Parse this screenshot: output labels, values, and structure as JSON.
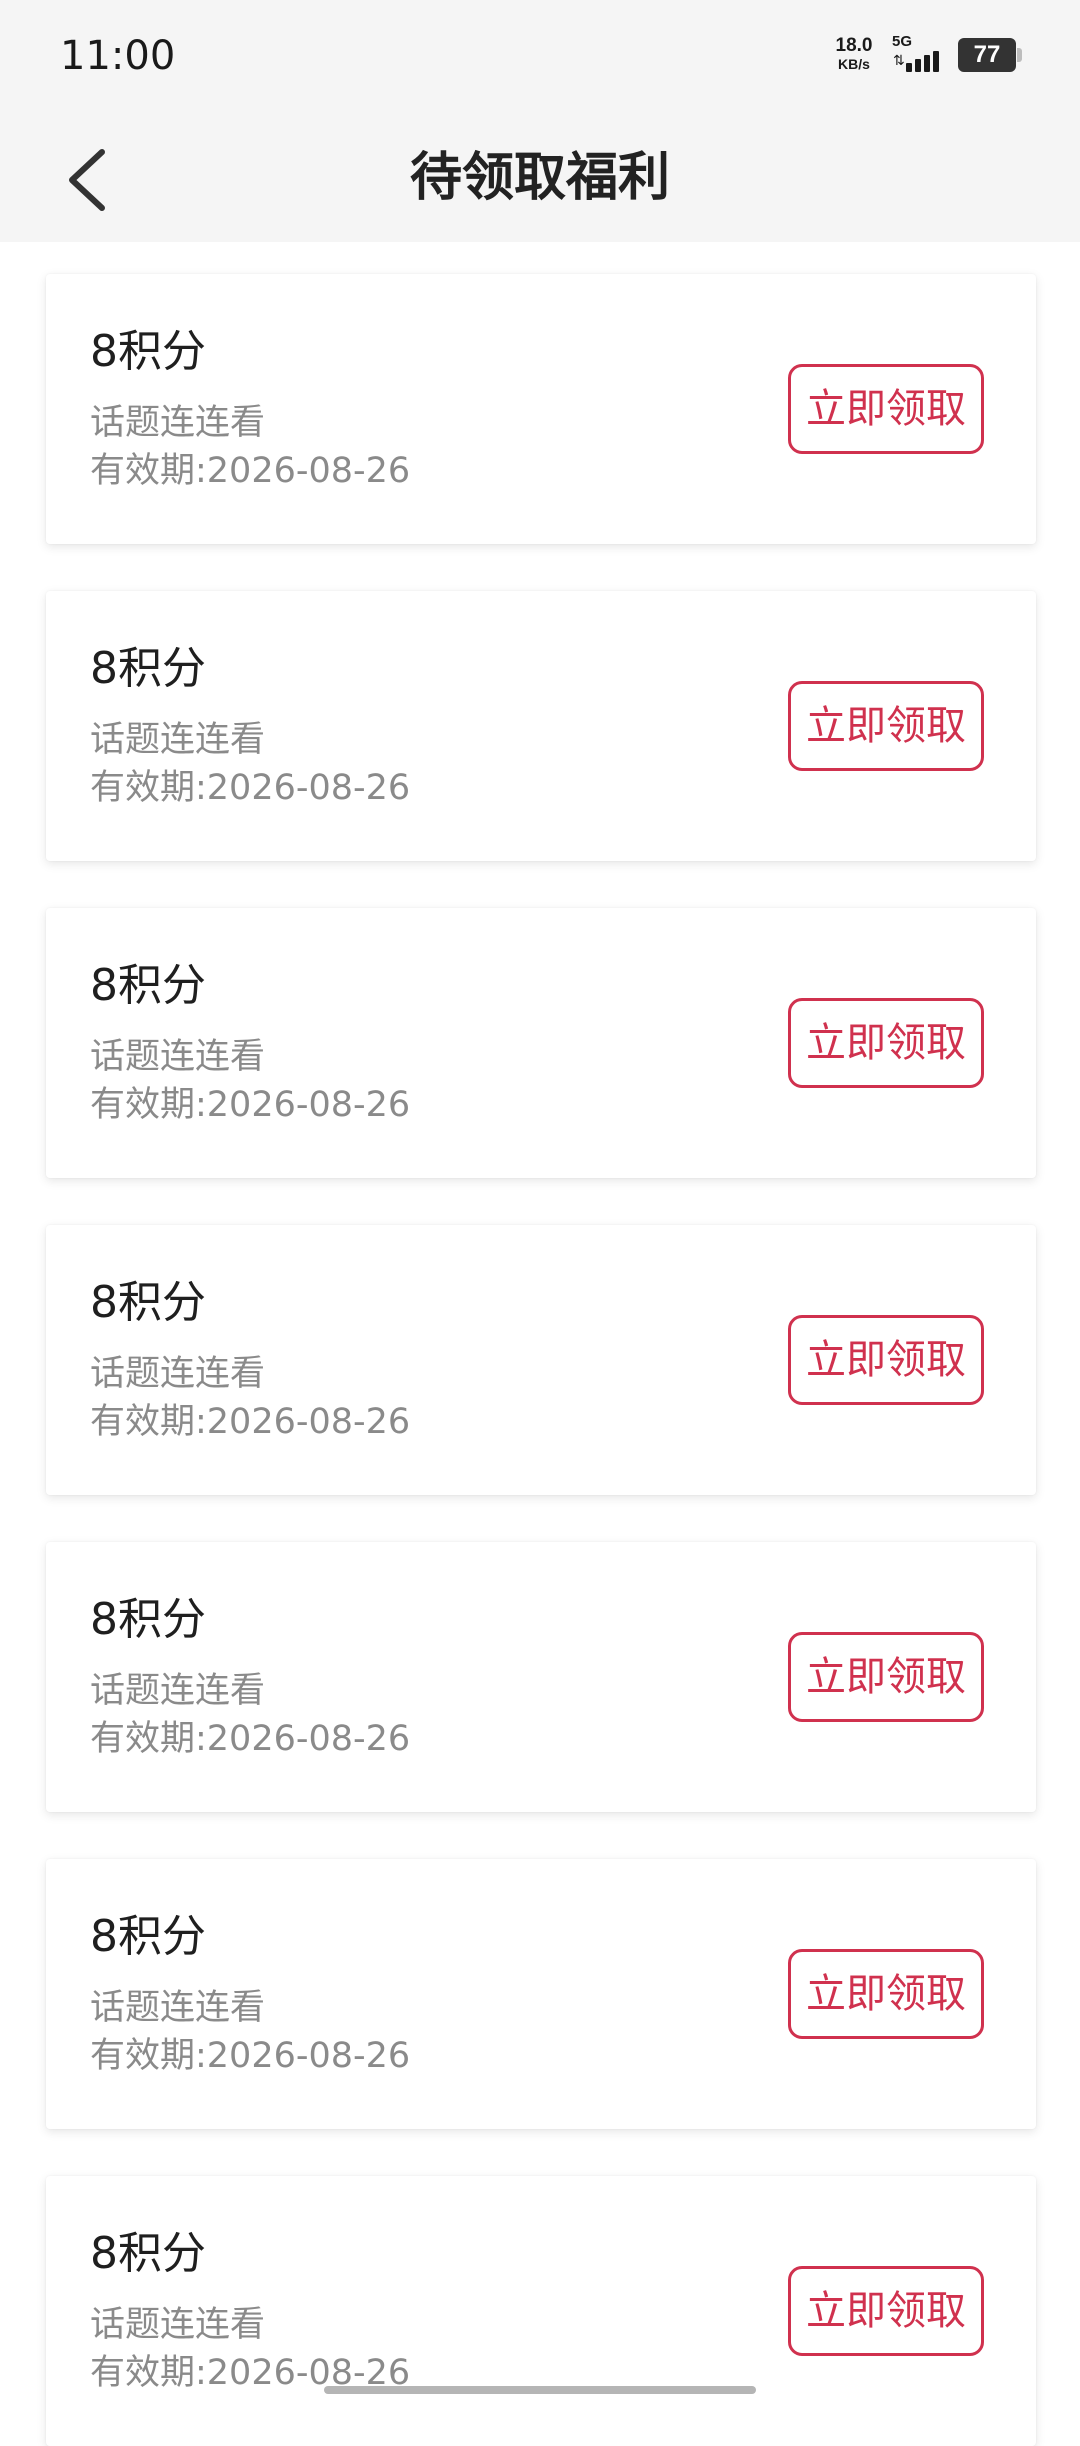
{
  "status_bar": {
    "time": "11:00",
    "net_speed": "18.0",
    "net_unit": "KB/s",
    "network_type": "5G",
    "battery": "77",
    "icons": [
      "signal-bars-icon",
      "data-arrows-icon",
      "battery-icon"
    ]
  },
  "header": {
    "title": "待领取福利",
    "back_icon": "chevron-left-icon"
  },
  "colors": {
    "accent": "#d0314e",
    "header_bg": "#f5f5f5",
    "secondary_text": "#8a8a8a"
  },
  "rewards": [
    {
      "points": "8积分",
      "desc": "话题连连看",
      "expiry": "有效期:2026-08-26",
      "button": "立即领取"
    },
    {
      "points": "8积分",
      "desc": "话题连连看",
      "expiry": "有效期:2026-08-26",
      "button": "立即领取"
    },
    {
      "points": "8积分",
      "desc": "话题连连看",
      "expiry": "有效期:2026-08-26",
      "button": "立即领取"
    },
    {
      "points": "8积分",
      "desc": "话题连连看",
      "expiry": "有效期:2026-08-26",
      "button": "立即领取"
    },
    {
      "points": "8积分",
      "desc": "话题连连看",
      "expiry": "有效期:2026-08-26",
      "button": "立即领取"
    },
    {
      "points": "8积分",
      "desc": "话题连连看",
      "expiry": "有效期:2026-08-26",
      "button": "立即领取"
    },
    {
      "points": "8积分",
      "desc": "话题连连看",
      "expiry": "有效期:2026-08-26",
      "button": "立即领取"
    }
  ]
}
